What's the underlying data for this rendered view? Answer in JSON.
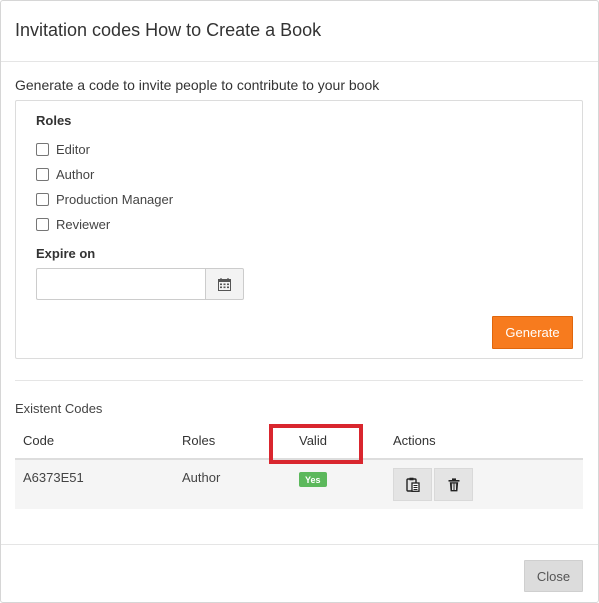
{
  "modal": {
    "title": "Invitation codes How to Create a Book",
    "intro": "Generate a code to invite people to contribute to your book"
  },
  "form": {
    "roles_label": "Roles",
    "roles": [
      {
        "label": "Editor",
        "checked": false
      },
      {
        "label": "Author",
        "checked": false
      },
      {
        "label": "Production Manager",
        "checked": false
      },
      {
        "label": "Reviewer",
        "checked": false
      }
    ],
    "expire_label": "Expire on",
    "expire_value": "",
    "calendar_icon": "calendar-icon",
    "generate_label": "Generate"
  },
  "codes": {
    "title": "Existent Codes",
    "columns": [
      "Code",
      "Roles",
      "Valid",
      "Actions"
    ],
    "rows": [
      {
        "code": "A6373E51",
        "roles": "Author",
        "valid": "Yes",
        "actions": [
          "clipboard-icon",
          "trash-icon"
        ]
      }
    ]
  },
  "footer": {
    "close_label": "Close"
  },
  "colors": {
    "accent": "#f77b1e",
    "valid_badge": "#5cb85c",
    "highlight": "#d9262e"
  }
}
